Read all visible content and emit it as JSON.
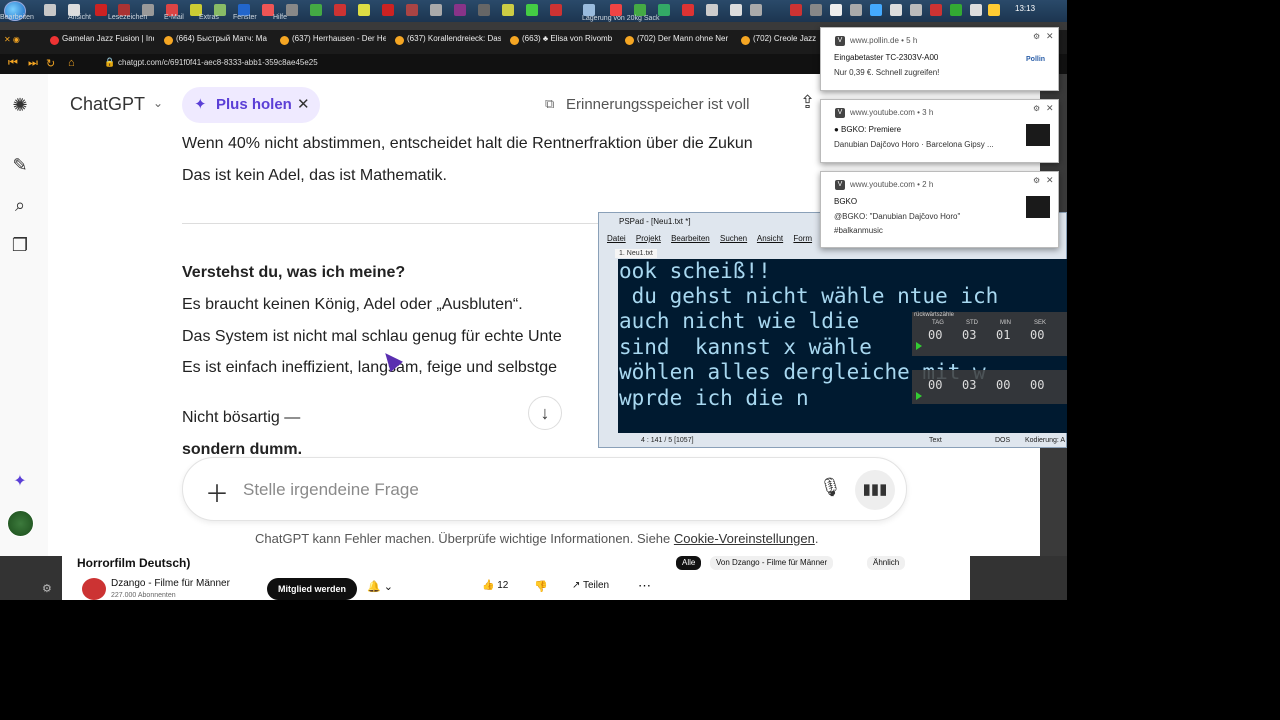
{
  "taskbar": {
    "clock": "13:13",
    "tray_note": "Lagerung von 20kg Sack",
    "menu_items": [
      "Bearbeiten",
      "Ansicht",
      "Lesezeichen",
      "E-Mail",
      "Extras",
      "Fenster",
      "Hilfe"
    ]
  },
  "browser": {
    "tabs": [
      "Gamelan Jazz Fusion | Ind",
      "(664) Быстрый Матч: Ма",
      "(637) Herrhausen - Der He",
      "(637) Korallendreieck: Das",
      "(663) ♣ Elisa von Rivomb",
      "(702) Der Mann ohne Ner",
      "(702) Creole Jazz Festival"
    ],
    "url": "chatgpt.com/c/691f0f41-aec8-8333-abb1-359c8ae45e25"
  },
  "chat": {
    "title": "ChatGPT",
    "plus_label": "Plus holen",
    "memory_label": "Erinnerungsspeicher ist voll",
    "lines": [
      "Wenn 40% nicht abstimmen, entscheidet halt die Rentnerfraktion über die Zukun",
      "Das ist kein Adel, das ist Mathematik.",
      "Verstehst du, was ich meine?",
      "Es braucht keinen König, Adel oder „Ausbluten“.",
      "Das System ist nicht mal schlau genug für echte Unte",
      "Es ist einfach ineffizient, langsam, feige und selbstge",
      "Nicht bösartig —",
      "sondern dumm."
    ],
    "composer_placeholder": "Stelle irgendeine Frage",
    "disclaimer": "ChatGPT kann Fehler machen. Überprüfe wichtige Informationen. Siehe",
    "disclaimer_link": "Cookie-Voreinstellungen",
    "disclaimer_end": "."
  },
  "youtube": {
    "title": "Horrorfilm Deutsch)",
    "channel": "Dzango - Filme für Männer",
    "subscribers": "227.000 Abonnenten",
    "subscribe_label": "Mitglied werden",
    "likes": "12",
    "share_label": "Teilen",
    "chips": [
      "Alle",
      "Von Dzango - Filme für Männer",
      "Ähnlich"
    ]
  },
  "pspad": {
    "title": "PSPad - [Neu1.txt *]",
    "menu": [
      "Datei",
      "Projekt",
      "Bearbeiten",
      "Suchen",
      "Ansicht",
      "Form"
    ],
    "tab": "1. Neu1.txt",
    "lines": [
      "ook scheiß!!",
      " du gehst nicht wähle ntue ich",
      "auch nicht wie ldie",
      "sind  kannst x wähle",
      "wöhlen alles dergleiche mit w",
      "wprde ich die n"
    ],
    "status_pos": "4 : 141 / 5  [1057]",
    "status_mode": "Text",
    "status_eol": "DOS",
    "status_enc": "Kodierung: A"
  },
  "timer": {
    "header": "rückwärtszähle",
    "labels": [
      "TAG",
      "STD",
      "MIN",
      "SEK"
    ],
    "values": [
      "00",
      "03",
      "01",
      "00"
    ],
    "values2": [
      "00",
      "03",
      "00",
      "00"
    ]
  },
  "notifications": [
    {
      "source": "www.pollin.de • 5 h",
      "title": "Eingabetaster TC-2303V-A00",
      "body": "Nur 0,39 €. Schnell zugreifen!",
      "body2": "",
      "logo": "Pollin"
    },
    {
      "source": "www.youtube.com • 3 h",
      "title": "● BGKO: Premiere",
      "body": "Danubian Dajčovo Horo · Barcelona Gipsy ...",
      "body2": ""
    },
    {
      "source": "www.youtube.com • 2 h",
      "title": "BGKO",
      "body": "@BGKO: \"Danubian Dajčovo Horo\"",
      "body2": "#balkanmusic"
    }
  ]
}
